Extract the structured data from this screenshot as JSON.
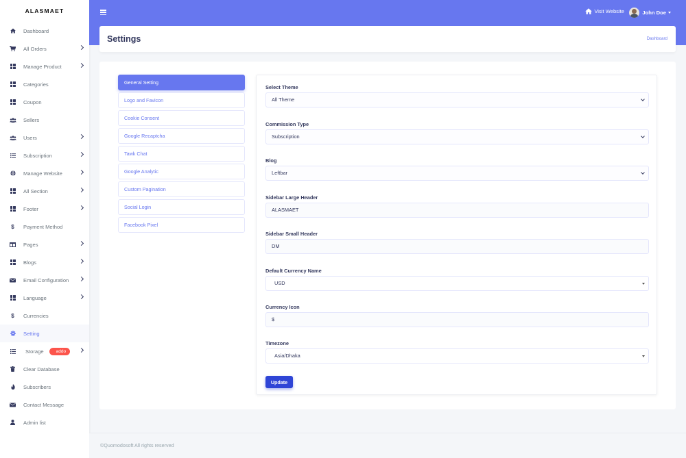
{
  "brand": "ALASMAET",
  "sidebar": {
    "items": [
      {
        "label": "Dashboard",
        "icon": "home-icon",
        "chevron": false
      },
      {
        "label": "All Orders",
        "icon": "cart-icon",
        "chevron": true
      },
      {
        "label": "Manage Product",
        "icon": "grid-icon",
        "chevron": true
      },
      {
        "label": "Categories",
        "icon": "grid-icon",
        "chevron": false
      },
      {
        "label": "Coupon",
        "icon": "grid-icon",
        "chevron": false
      },
      {
        "label": "Sellers",
        "icon": "users-icon",
        "chevron": false
      },
      {
        "label": "Users",
        "icon": "users-icon",
        "chevron": true
      },
      {
        "label": "Subscription",
        "icon": "list-icon",
        "chevron": true
      },
      {
        "label": "Manage Website",
        "icon": "globe-icon",
        "chevron": true
      },
      {
        "label": "All Section",
        "icon": "grid-icon",
        "chevron": true
      },
      {
        "label": "Footer",
        "icon": "grid-icon",
        "chevron": true
      },
      {
        "label": "Payment Method",
        "icon": "dollar-icon",
        "chevron": false
      },
      {
        "label": "Pages",
        "icon": "columns-icon",
        "chevron": true
      },
      {
        "label": "Blogs",
        "icon": "grid-icon",
        "chevron": true
      },
      {
        "label": "Email Configuration",
        "icon": "envelope-icon",
        "chevron": true
      },
      {
        "label": "Language",
        "icon": "grid-icon",
        "chevron": true
      },
      {
        "label": "Currencies",
        "icon": "dollar-icon",
        "chevron": false
      },
      {
        "label": "Setting",
        "icon": "gear-icon",
        "chevron": false,
        "active": true
      },
      {
        "label": "Storage",
        "icon": "list-icon",
        "chevron": true,
        "badge": "addo"
      },
      {
        "label": "Clear Database",
        "icon": "trash-icon",
        "chevron": false
      },
      {
        "label": "Subscribers",
        "icon": "fire-icon",
        "chevron": false
      },
      {
        "label": "Contact Message",
        "icon": "envelope-icon",
        "chevron": false
      },
      {
        "label": "Admin list",
        "icon": "user-icon",
        "chevron": false
      }
    ]
  },
  "navbar": {
    "visit_label": "Visit Website",
    "user_name": "John Doe"
  },
  "header": {
    "title": "Settings",
    "breadcrumb": "Dashboard"
  },
  "tabs": [
    "General Setting",
    "Logo and Favicon",
    "Cookie Consent",
    "Google Recaptcha",
    "Tawk Chat",
    "Google Analytic",
    "Custom Pagination",
    "Social Login",
    "Facebook Pixel"
  ],
  "form": {
    "theme_label": "Select Theme",
    "theme_value": "All Theme",
    "commission_label": "Commission Type",
    "commission_value": "Subscription",
    "blog_label": "Blog",
    "blog_value": "Leftbar",
    "large_header_label": "Sidebar Large Header",
    "large_header_value": "ALASMAET",
    "small_header_label": "Sidebar Small Header",
    "small_header_value": "DM",
    "currency_name_label": "Default Currency Name",
    "currency_name_value": "USD",
    "currency_icon_label": "Currency Icon",
    "currency_icon_value": "$",
    "timezone_label": "Timezone",
    "timezone_value": "Asia/Dhaka",
    "update_label": "Update"
  },
  "footer": {
    "text": "©Quomodosoft All rights reserved"
  },
  "colors": {
    "primary": "#6777ef",
    "button": "#2f45d6",
    "badge": "#fc544b"
  }
}
